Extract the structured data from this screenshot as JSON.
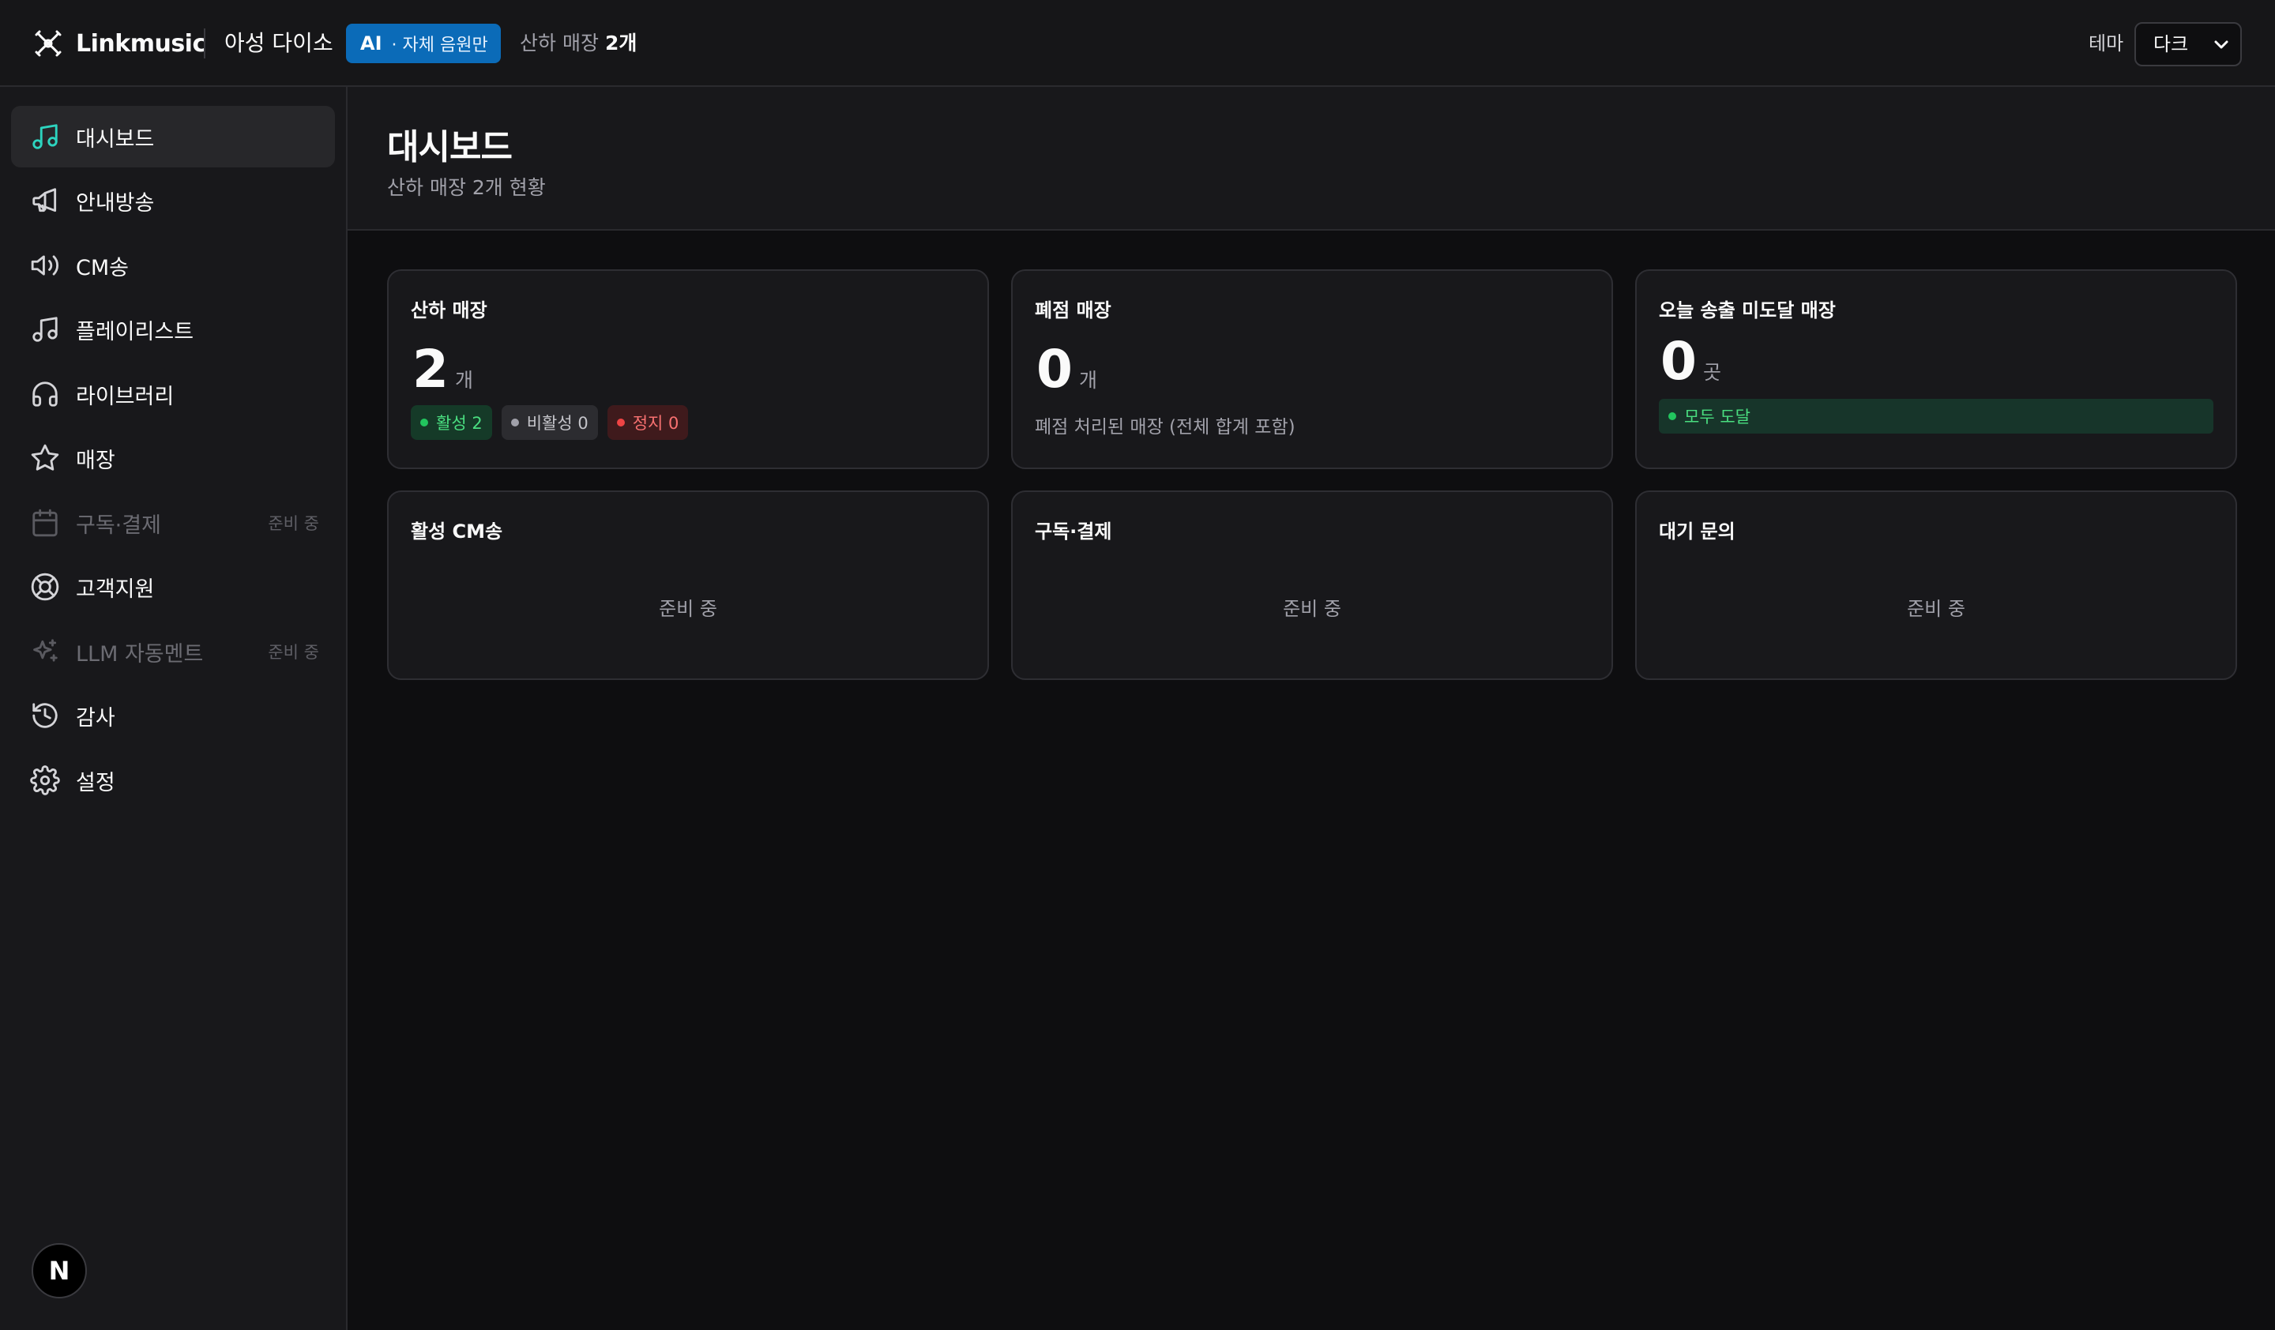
{
  "header": {
    "brand_name": "Linkmusic",
    "tenant_name": "아성 다이소",
    "ai_badge_prefix": "AI",
    "ai_badge_text": "· 자체 음원만",
    "store_count_label": "산하 매장",
    "store_count_value": "2개",
    "theme_label": "테마",
    "theme_selected": "다크"
  },
  "sidebar": {
    "items": [
      {
        "label": "대시보드",
        "icon": "music-note-icon",
        "active": true
      },
      {
        "label": "안내방송",
        "icon": "megaphone-icon"
      },
      {
        "label": "CM송",
        "icon": "speaker-icon"
      },
      {
        "label": "플레이리스트",
        "icon": "music-note-icon"
      },
      {
        "label": "라이브러리",
        "icon": "headphones-icon"
      },
      {
        "label": "매장",
        "icon": "star-icon"
      },
      {
        "label": "구독·결제",
        "icon": "calendar-icon",
        "disabled": true,
        "badge": "준비 중"
      },
      {
        "label": "고객지원",
        "icon": "lifebuoy-icon"
      },
      {
        "label": "LLM 자동멘트",
        "icon": "sparkles-icon",
        "disabled": true,
        "badge": "준비 중"
      },
      {
        "label": "감사",
        "icon": "history-icon"
      },
      {
        "label": "설정",
        "icon": "gear-icon"
      }
    ],
    "avatar_letter": "N"
  },
  "page": {
    "title": "대시보드",
    "subtitle": "산하 매장 2개 현황"
  },
  "cards": {
    "stores": {
      "title": "산하 매장",
      "value": "2",
      "unit": "개",
      "chip_active": "활성 2",
      "chip_inactive": "비활성 0",
      "chip_stopped": "정지 0"
    },
    "closed": {
      "title": "폐점 매장",
      "value": "0",
      "unit": "개",
      "note": "폐점 처리된 매장 (전체 합계 포함)"
    },
    "undelivered": {
      "title": "오늘 송출 미도달 매장",
      "value": "0",
      "unit": "곳",
      "status": "모두 도달"
    },
    "active_cm": {
      "title": "활성 CM송",
      "placeholder": "준비 중"
    },
    "subscription": {
      "title": "구독·결제",
      "placeholder": "준비 중"
    },
    "inquiries": {
      "title": "대기 문의",
      "placeholder": "준비 중"
    }
  },
  "colors": {
    "accent": "#0b6bb8",
    "active_icon": "#2dd4bf",
    "success": "#22c55e",
    "danger": "#ef4444"
  }
}
